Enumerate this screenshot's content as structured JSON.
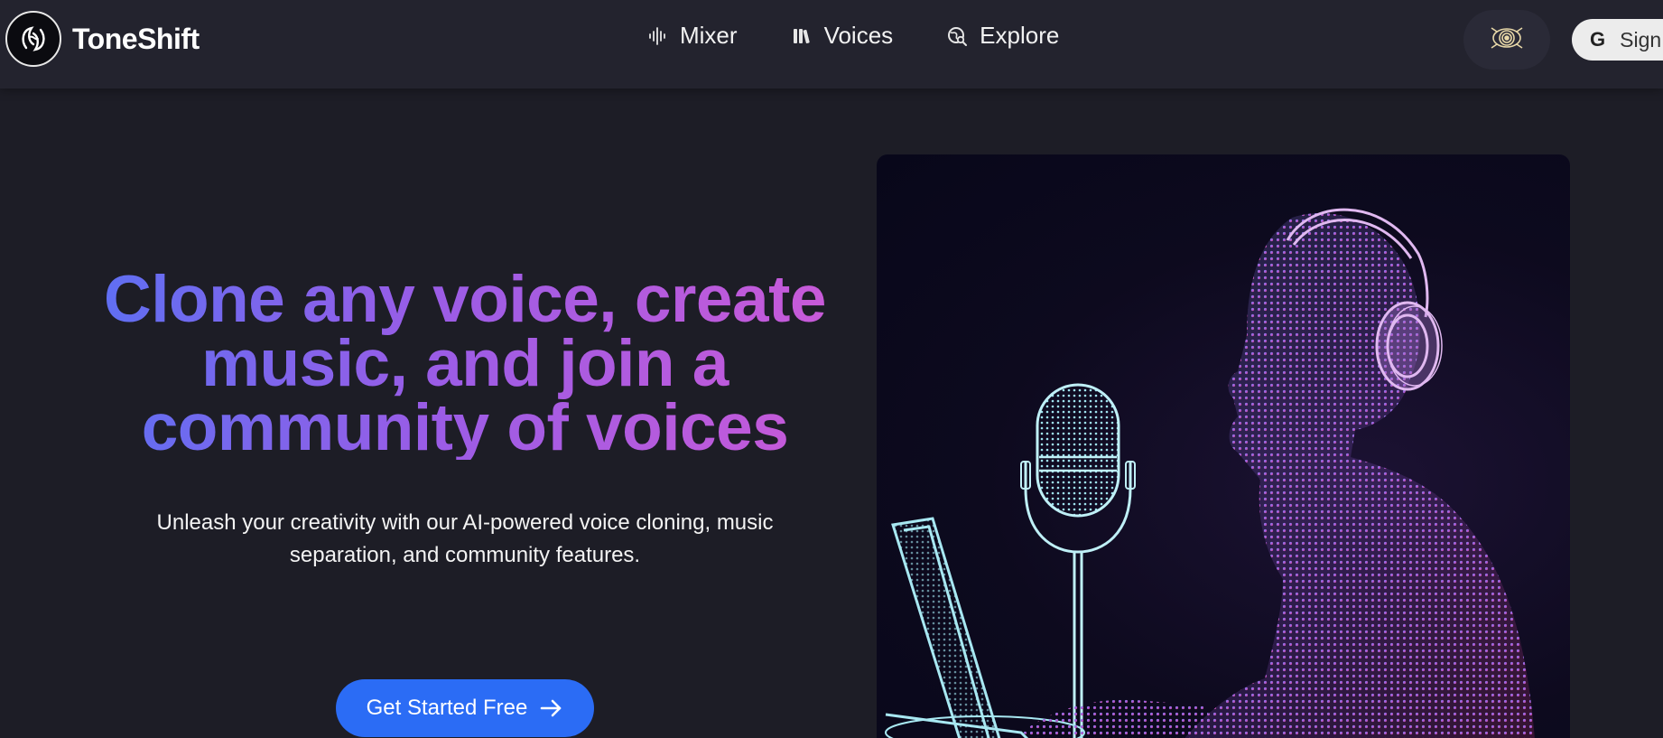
{
  "header": {
    "brand_name": "ToneShift",
    "nav": [
      {
        "label": "Mixer",
        "icon": "waveform-icon"
      },
      {
        "label": "Voices",
        "icon": "library-icon"
      },
      {
        "label": "Explore",
        "icon": "globe-search-icon"
      }
    ],
    "theme_icon": "spiral-eye-icon",
    "signin_label": "Sign",
    "signin_icon": "google-icon"
  },
  "hero": {
    "headline": "Clone any voice, create music, and join a community of voices",
    "subtitle": "Unleash your creativity with our AI-powered voice cloning, music separation, and community features.",
    "cta_label": "Get Started Free",
    "cta_icon": "arrow-right-icon",
    "image": "dotted-person-headphones-microphone-laptop-illustration"
  },
  "colors": {
    "background": "#1d1d26",
    "topbar": "#23232e",
    "cta": "#2b6cf5",
    "headline_gradient_start": "#5f6ff2",
    "headline_gradient_end": "#c85ad8"
  }
}
